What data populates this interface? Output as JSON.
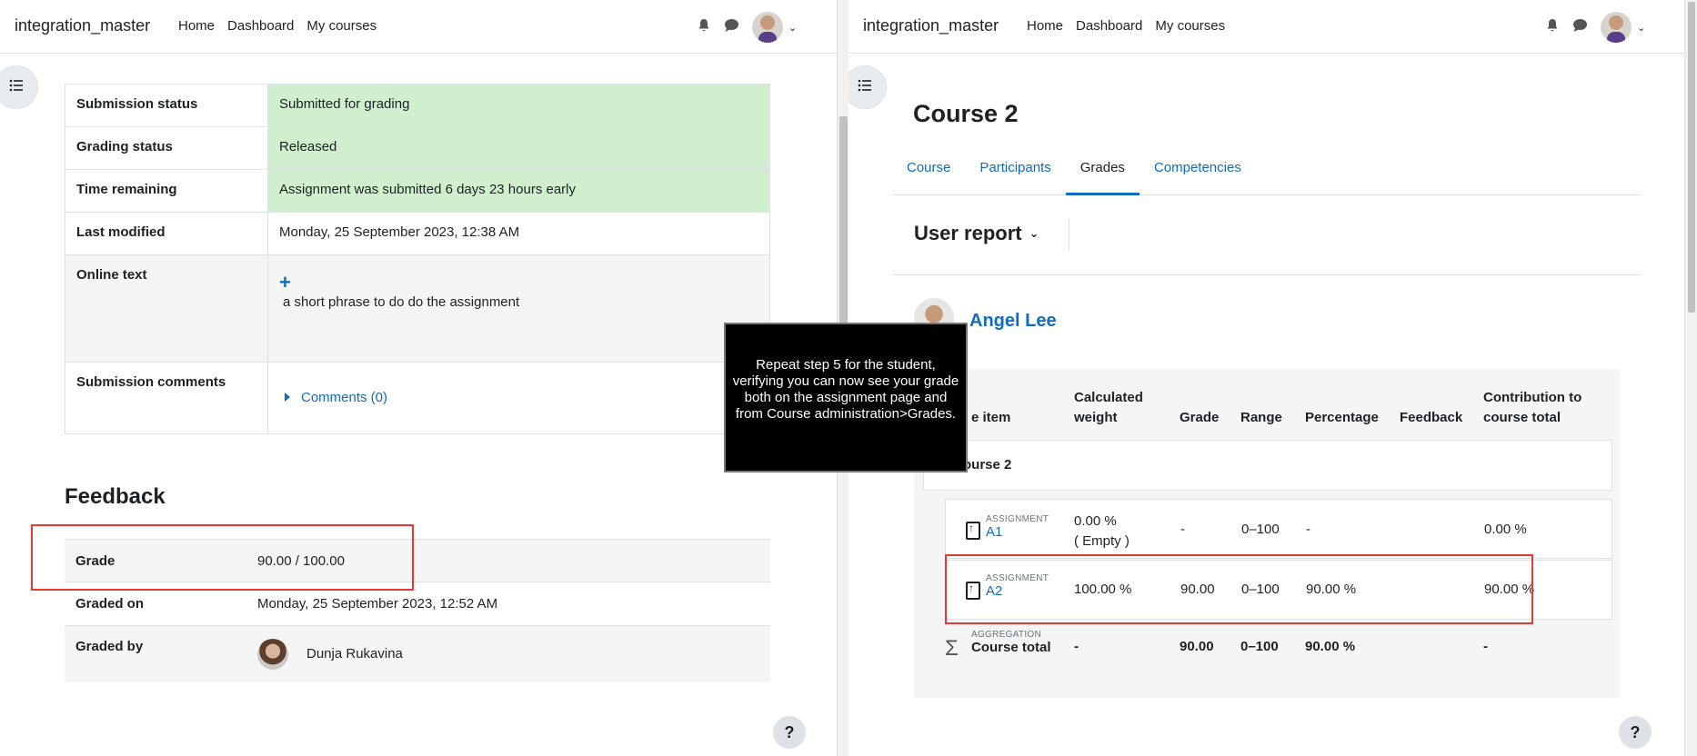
{
  "left": {
    "nav": {
      "brand": "integration_master",
      "links": [
        "Home",
        "Dashboard",
        "My courses"
      ]
    },
    "submission": {
      "rows": [
        {
          "label": "Submission status",
          "value": "Submitted for grading"
        },
        {
          "label": "Grading status",
          "value": "Released"
        },
        {
          "label": "Time remaining",
          "value": "Assignment was submitted 6 days 23 hours early"
        },
        {
          "label": "Last modified",
          "value": "Monday, 25 September 2023, 12:38 AM"
        },
        {
          "label": "Online text",
          "plus": "+",
          "value": "a short phrase to do do the assignment"
        },
        {
          "label": "Submission comments",
          "value": "Comments (0)"
        }
      ]
    },
    "feedback": {
      "title": "Feedback",
      "grade_label": "Grade",
      "grade_value": "90.00 / 100.00",
      "graded_on_label": "Graded on",
      "graded_on_value": "Monday, 25 September 2023, 12:52 AM",
      "graded_by_label": "Graded by",
      "graded_by_value": "Dunja Rukavina"
    },
    "help": "?"
  },
  "right": {
    "nav": {
      "brand": "integration_master",
      "links": [
        "Home",
        "Dashboard",
        "My courses"
      ]
    },
    "course_title": "Course 2",
    "tabs": [
      "Course",
      "Participants",
      "Grades",
      "Competencies"
    ],
    "active_tab": "Grades",
    "report_selector": "User report",
    "user_name": "Angel Lee",
    "columns": {
      "item": "e item",
      "weight_1": "Calculated",
      "weight_2": "weight",
      "grade": "Grade",
      "range": "Range",
      "percentage": "Percentage",
      "feedback": "Feedback",
      "contribution_1": "Contribution to",
      "contribution_2": "course total"
    },
    "category": "ourse 2",
    "items": [
      {
        "type": "ASSIGNMENT",
        "name": "A1",
        "weight": "0.00 %",
        "weight_note": "( Empty )",
        "grade": "-",
        "range": "0–100",
        "percentage": "-",
        "contribution": "0.00 %"
      },
      {
        "type": "ASSIGNMENT",
        "name": "A2",
        "weight": "100.00 %",
        "grade": "90.00",
        "range": "0–100",
        "percentage": "90.00 %",
        "contribution": "90.00 %"
      }
    ],
    "total": {
      "type": "AGGREGATION",
      "name": "Course total",
      "weight": "-",
      "grade": "90.00",
      "range": "0–100",
      "percentage": "90.00 %",
      "contribution": "-"
    },
    "help": "?"
  },
  "tooltip": "Repeat step 5 for the student, verifying you can now see your grade both on the assignment page and from Course administration>Grades."
}
